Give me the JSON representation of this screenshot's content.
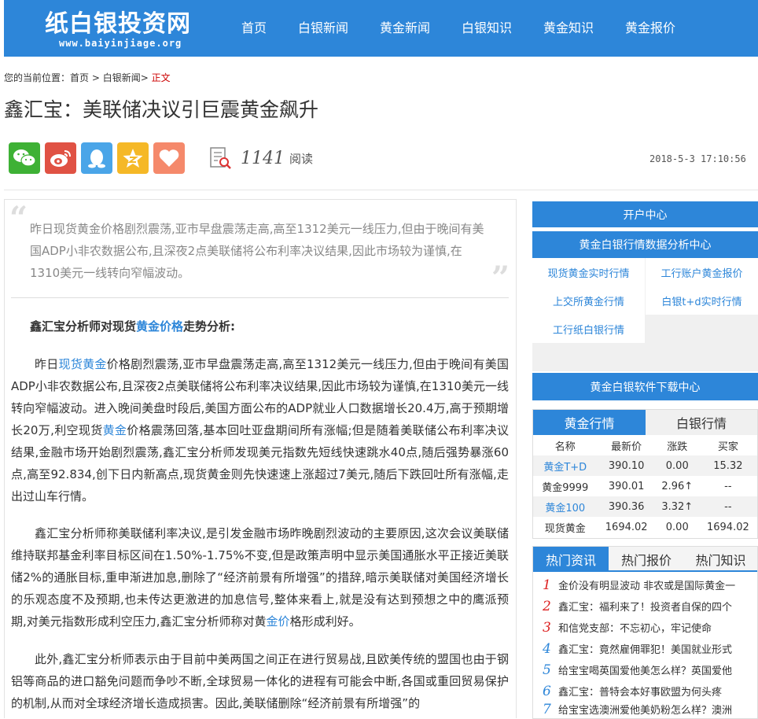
{
  "header": {
    "logo": "纸白银投资网",
    "logo_url": "www.baiyinjiage.org",
    "nav": [
      "首页",
      "白银新闻",
      "黄金新闻",
      "白银知识",
      "黄金知识",
      "黄金报价"
    ]
  },
  "breadcrumb": {
    "prefix": "您的当前位置：",
    "home": "首页",
    "sep1": " > ",
    "section": "白银新闻",
    "sep2": "> ",
    "current": "正文"
  },
  "article": {
    "title": "鑫汇宝：美联储决议引巨震黄金飙升",
    "reads_count": "1141",
    "reads_label": "阅读",
    "date": "2018-5-3 17:10:56",
    "summary": "昨日现货黄金价格剧烈震荡,亚市早盘震荡走高,高至1312美元一线压力,但由于晚间有美国ADP小非农数据公布,且深夜2点美联储将公布利率决议结果,因此市场较为谨慎,在1310美元一线转向窄幅波动。",
    "subhead_pre": "鑫汇宝分析师对现货",
    "subhead_link": "黄金价格",
    "subhead_post": "走势分析:",
    "p1_a": "昨日",
    "p1_link1": "现货黄金",
    "p1_b": "价格剧烈震荡,亚市早盘震荡走高,高至1312美元一线压力,但由于晚间有美国ADP小非农数据公布,且深夜2点美联储将公布利率决议结果,因此市场较为谨慎,在1310美元一线转向窄幅波动。进入晚间美盘时段后,美国方面公布的ADP就业人口数据增长20.4万,高于预期增长20万,利空现货",
    "p1_link2": "黄金",
    "p1_c": "价格震荡回落,基本回吐亚盘期间所有涨幅;但是随着美联储公布利率决议结果,金融市场开始剧烈震荡,鑫汇宝分析师发现美元指数先短线快速跳水40点,随后强势暴涨60点,高至92.834,创下日内新高点,现货黄金则先快速速上涨超过7美元,随后下跌回吐所有涨幅,走出过山车行情。",
    "p2_a": "鑫汇宝分析师称美联储利率决议,是引发金融市场昨晚剧烈波动的主要原因,这次会议美联储维持联邦基金利率目标区间在1.50%-1.75%不变,但是政策声明中显示美国通胀水平正接近美联储2%的通胀目标,重申渐进加息,删除了“经济前景有所增强”的措辞,暗示美联储对美国经济增长的乐观态度不及预期,也未传达更激进的加息信号,整体来看上,就是没有达到预想之中的鹰派预期,对美元指数形成利空压力,鑫汇宝分析师称对黄",
    "p2_link": "金价",
    "p2_b": "格形成利好。",
    "p3": "此外,鑫汇宝分析师表示由于目前中美两国之间正在进行贸易战,且欧美传统的盟国也由于钢铝等商品的进口豁免问题而争吵不断,全球贸易一体化的进程有可能会中断,各国或重回贸易保护的机制,从而对全球经济增长造成损害。因此,美联储删除“经济前景有所增强”的"
  },
  "sidebar": {
    "open_account": "开户中心",
    "analysis_center": "黄金白银行情数据分析中心",
    "links": [
      "现货黄金实时行情",
      "工行账户黄金报价",
      "上交所黄金行情",
      "白银t+d实时行情",
      "工行纸白银行情"
    ],
    "download_center": "黄金白银软件下载中心",
    "market_tabs": [
      "黄金行情",
      "白银行情"
    ],
    "market_headers": [
      "名称",
      "最新价",
      "涨跌",
      "买家"
    ],
    "market_rows": [
      {
        "name": "黄金T+D",
        "price": "390.10",
        "change": "0.00",
        "bid": "15.32"
      },
      {
        "name": "黄金9999",
        "price": "390.01",
        "change": "2.96↑",
        "bid": "--"
      },
      {
        "name": "黄金100",
        "price": "390.36",
        "change": "3.32↑",
        "bid": "--"
      },
      {
        "name": "现货黄金",
        "price": "1694.02",
        "change": "0.00",
        "bid": "1694.02"
      }
    ],
    "hot_tabs": [
      "热门资讯",
      "热门报价",
      "热门知识"
    ],
    "hot_items": [
      {
        "n": "1",
        "t": "金价没有明显波动 非农或是国际黄金一"
      },
      {
        "n": "2",
        "t": "鑫汇宝：福利来了！投资者自保的四个"
      },
      {
        "n": "3",
        "t": "和信党支部：不忘初心，牢记使命"
      },
      {
        "n": "4",
        "t": "鑫汇宝：竟然雇佣罪犯！美国就业形式"
      },
      {
        "n": "5",
        "t": "给宝宝喝英国爱他美怎么样？英国爱他"
      },
      {
        "n": "6",
        "t": "鑫汇宝：普特会本好事欧盟为何头疼"
      },
      {
        "n": "7",
        "t": "给宝宝选澳洲爱他美奶粉怎么样？澳洲"
      }
    ]
  },
  "colors": {
    "accent": "#2d86d9",
    "highlight_red": "#cc0000"
  }
}
